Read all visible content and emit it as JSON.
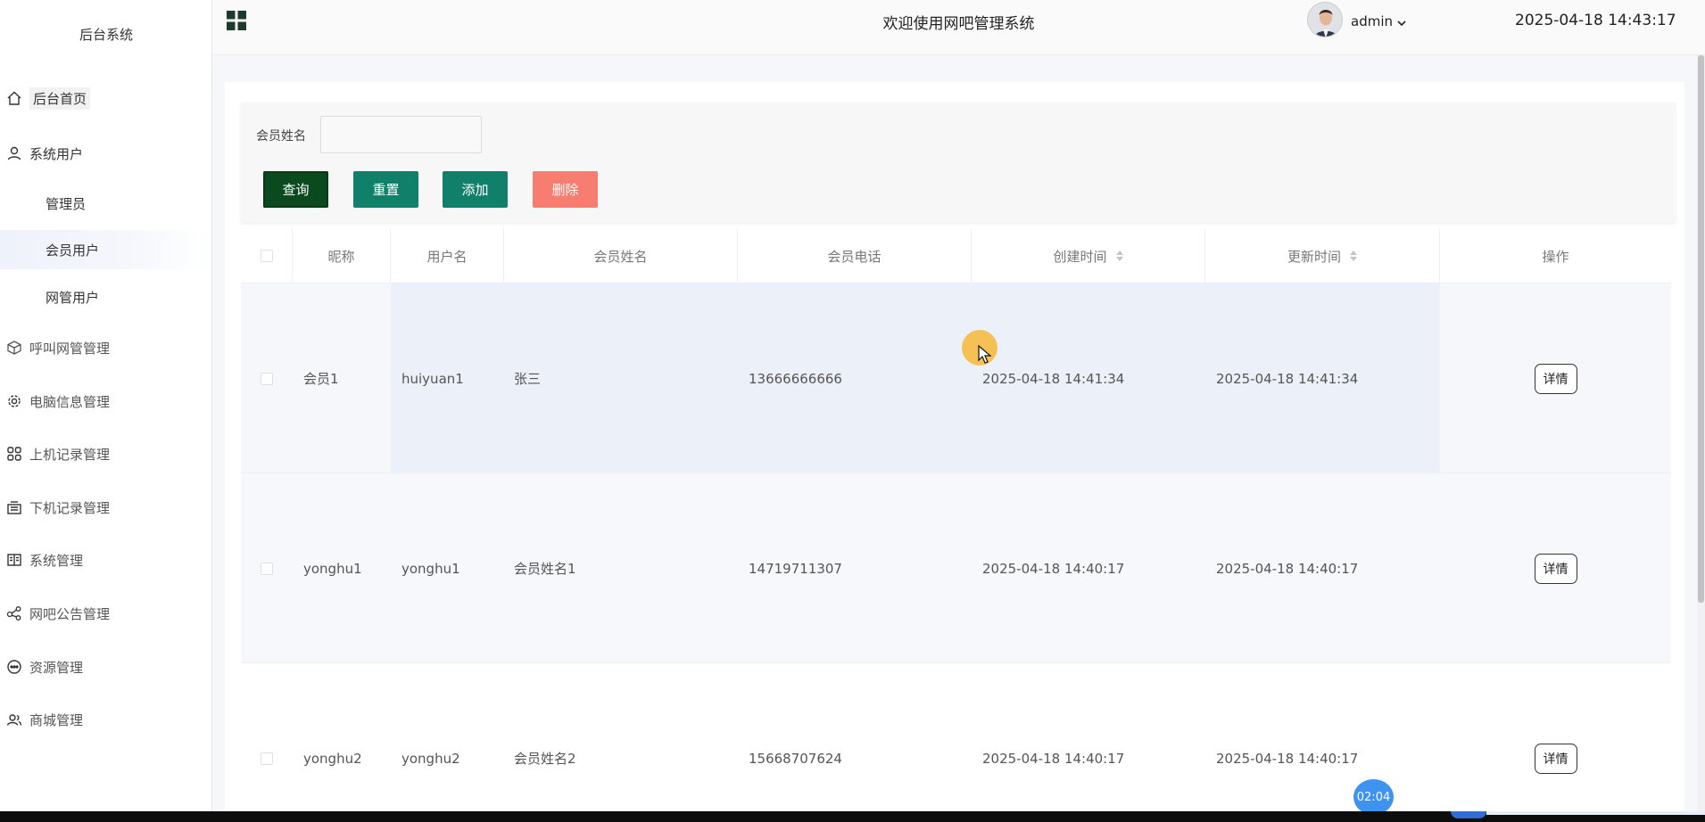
{
  "sidebar": {
    "brand": "后台系统",
    "items": [
      {
        "label": "后台首页",
        "icon": "home-icon"
      },
      {
        "label": "系统用户",
        "icon": "user-icon"
      },
      {
        "label": "管理员",
        "icon": ""
      },
      {
        "label": "会员用户",
        "icon": ""
      },
      {
        "label": "网管用户",
        "icon": ""
      },
      {
        "label": "呼叫网管管理",
        "icon": "cube-icon"
      },
      {
        "label": "电脑信息管理",
        "icon": "gear-icon"
      },
      {
        "label": "上机记录管理",
        "icon": "grid-icon"
      },
      {
        "label": "下机记录管理",
        "icon": "tray-icon"
      },
      {
        "label": "系统管理",
        "icon": "book-icon"
      },
      {
        "label": "网吧公告管理",
        "icon": "share-icon"
      },
      {
        "label": "资源管理",
        "icon": "chat-icon"
      },
      {
        "label": "商城管理",
        "icon": "users-icon"
      }
    ]
  },
  "header": {
    "title": "欢迎使用网吧管理系统",
    "user": "admin",
    "datetime": "2025-04-18 14:43:17"
  },
  "search": {
    "label": "会员姓名",
    "value": "",
    "placeholder": ""
  },
  "buttons": {
    "query": "查询",
    "reset": "重置",
    "add": "添加",
    "delete": "删除"
  },
  "table": {
    "columns": [
      "昵称",
      "用户名",
      "会员姓名",
      "会员电话",
      "创建时间",
      "更新时间",
      "操作"
    ],
    "rows": [
      {
        "nickname": "会员1",
        "username": "huiyuan1",
        "name": "张三",
        "phone": "13666666666",
        "created": "2025-04-18 14:41:34",
        "updated": "2025-04-18 14:41:34",
        "action": "详情"
      },
      {
        "nickname": "yonghu1",
        "username": "yonghu1",
        "name": "会员姓名1",
        "phone": "14719711307",
        "created": "2025-04-18 14:40:17",
        "updated": "2025-04-18 14:40:17",
        "action": "详情"
      },
      {
        "nickname": "yonghu2",
        "username": "yonghu2",
        "name": "会员姓名2",
        "phone": "15668707624",
        "created": "2025-04-18 14:40:17",
        "updated": "2025-04-18 14:40:17",
        "action": "详情"
      }
    ]
  },
  "overlay": {
    "timer": "02:04"
  },
  "colors": {
    "query": "#0a4a1e",
    "primary": "#11806a",
    "danger": "#f77d70",
    "cursor": "#f7b838",
    "timer": "#3f93f0"
  }
}
